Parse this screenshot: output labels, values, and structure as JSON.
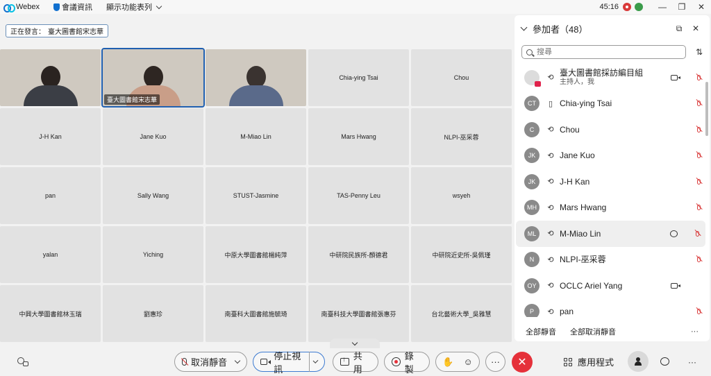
{
  "titlebar": {
    "app_name": "Webex",
    "meeting_info": "會議資訊",
    "layout_menu": "顯示功能表列",
    "timer": "45:16",
    "minimize": "—",
    "restore": "❐",
    "close": "✕"
  },
  "speaking": {
    "label": "正在發言：",
    "name": "臺大圖書館宋志華"
  },
  "grid": {
    "video_tiles": [
      {
        "name": ""
      },
      {
        "name": "臺大圖書館宋志華"
      },
      {
        "name": ""
      }
    ],
    "tiles": [
      "Chia-ying Tsai",
      "Chou",
      "J-H Kan",
      "Jane Kuo",
      "M-Miao Lin",
      "Mars Hwang",
      "NLPI-巫采蓉",
      "pan",
      "Sally Wang",
      "STUST-Jasmine",
      "TAS-Penny Leu",
      "wsyeh",
      "yalan",
      "Yiching",
      "中原大學圖書館楊純萍",
      "中研院民族所-顏德君",
      "中研院近史所-吳佩瑾",
      "中興大學圖書館林玉瑞",
      "劉惠珍",
      "南臺科大圖書館施毓琦",
      "南臺科技大學圖書館張惠芬",
      "台北藝術大學_吳雅慧"
    ]
  },
  "panel": {
    "title": "參加者（48）",
    "search_placeholder": "搜尋",
    "participants": [
      {
        "initials": "",
        "name": "臺大圖書館採訪編目組",
        "sub": "主持人，我",
        "audio": "⟲",
        "extra": "cam",
        "muted": true
      },
      {
        "initials": "CT",
        "name": "Chia-ying Tsai",
        "sub": "",
        "audio": "▯",
        "extra": "",
        "muted": true
      },
      {
        "initials": "C",
        "name": "Chou",
        "sub": "",
        "audio": "⟲",
        "extra": "",
        "muted": true
      },
      {
        "initials": "JK",
        "name": "Jane Kuo",
        "sub": "",
        "audio": "⟲",
        "extra": "",
        "muted": true
      },
      {
        "initials": "JK",
        "name": "J-H Kan",
        "sub": "",
        "audio": "⟲",
        "extra": "",
        "muted": true
      },
      {
        "initials": "MH",
        "name": "Mars Hwang",
        "sub": "",
        "audio": "⟲",
        "extra": "",
        "muted": true
      },
      {
        "initials": "ML",
        "name": "M-Miao Lin",
        "sub": "",
        "audio": "⟲",
        "extra": "chat",
        "muted": true
      },
      {
        "initials": "N",
        "name": "NLPI-巫采蓉",
        "sub": "",
        "audio": "⟲",
        "extra": "",
        "muted": true
      },
      {
        "initials": "OY",
        "name": "OCLC Ariel Yang",
        "sub": "",
        "audio": "⟲",
        "extra": "cam",
        "muted": false
      },
      {
        "initials": "P",
        "name": "pan",
        "sub": "",
        "audio": "⟲",
        "extra": "",
        "muted": true
      }
    ],
    "mute_all": "全部靜音",
    "unmute_all": "全部取消靜音",
    "more": "···"
  },
  "toolbar": {
    "unmute_label": "取消靜音",
    "stop_video_label": "停止視訊",
    "share_label": "共用",
    "record_label": "錄製",
    "more": "···",
    "leave": "✕",
    "apps_label": "應用程式",
    "more_right": "···"
  },
  "colors": {
    "accent": "#1f5fb0",
    "leave_red": "#e5313a",
    "mute_red": "#d93a3a"
  }
}
